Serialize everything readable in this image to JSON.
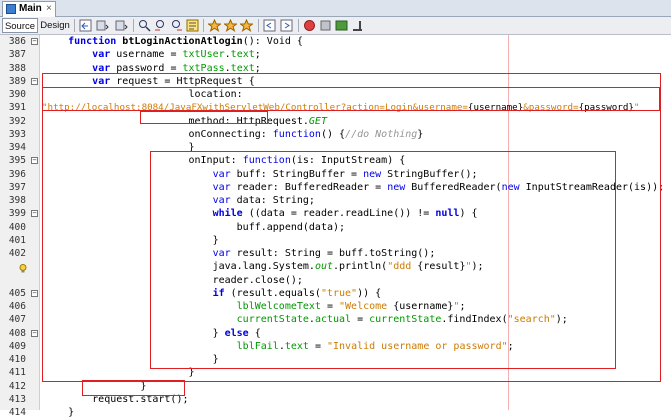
{
  "tab": {
    "title": "Main",
    "close": "×"
  },
  "toolbar": {
    "source_label": "Source",
    "design_label": "Design"
  },
  "colors": {
    "highlight_box": "#e02020",
    "keyword": "#0000e6",
    "string": "#ce7b00",
    "field": "#009900"
  },
  "code": {
    "lines": [
      {
        "n": "386",
        "fold": "minus",
        "text": "    function btLoginActionAtlogin(): Void {"
      },
      {
        "n": "387",
        "fold": "",
        "text": "        var username = txtUser.text;"
      },
      {
        "n": "388",
        "fold": "",
        "text": "        var password = txtPass.text;"
      },
      {
        "n": "389",
        "fold": "minus",
        "text": "        var request = HttpRequest {"
      },
      {
        "n": "390",
        "fold": "",
        "text": "                        location:"
      },
      {
        "n": "391",
        "fold": "",
        "text": "\"http://localhost:8084/JavaFXwithServletWeb/Controller?action=Login&username={username}&password={password}\""
      },
      {
        "n": "392",
        "fold": "",
        "text": "                        method: HttpRequest.GET"
      },
      {
        "n": "393",
        "fold": "",
        "text": "                        onConnecting: function() {//do Nothing}"
      },
      {
        "n": "394",
        "fold": "",
        "text": "                        }"
      },
      {
        "n": "395",
        "fold": "minus",
        "text": "                        onInput: function(is: InputStream) {"
      },
      {
        "n": "396",
        "fold": "",
        "text": "                            var buff: StringBuffer = new StringBuffer();"
      },
      {
        "n": "397",
        "fold": "",
        "text": "                            var reader: BufferedReader = new BufferedReader(new InputStreamReader(is));"
      },
      {
        "n": "398",
        "fold": "",
        "text": "                            var data: String;"
      },
      {
        "n": "399",
        "fold": "minus",
        "text": "                            while ((data = reader.readLine()) != null) {"
      },
      {
        "n": "400",
        "fold": "",
        "text": "                                buff.append(data);"
      },
      {
        "n": "401",
        "fold": "",
        "text": "                            }"
      },
      {
        "n": "402",
        "fold": "",
        "text": "                            var result: String = buff.toString();"
      },
      {
        "n": "",
        "fold": "",
        "text": "                            java.lang.System.out.println(\"ddd {result}\");"
      },
      {
        "n": "",
        "fold": "",
        "text": "                            reader.close();"
      },
      {
        "n": "405",
        "fold": "minus",
        "text": "                            if (result.equals(\"true\")) {"
      },
      {
        "n": "406",
        "fold": "",
        "text": "                                lblWelcomeText = \"Welcome {username}\";"
      },
      {
        "n": "407",
        "fold": "",
        "text": "                                currentState.actual = currentState.findIndex(\"search\");"
      },
      {
        "n": "408",
        "fold": "minus",
        "text": "                            } else {"
      },
      {
        "n": "409",
        "fold": "",
        "text": "                                lblFail.text = \"Invalid username or password\";"
      },
      {
        "n": "410",
        "fold": "",
        "text": "                            }"
      },
      {
        "n": "411",
        "fold": "",
        "text": "                        }"
      },
      {
        "n": "412",
        "fold": "",
        "text": "                }"
      },
      {
        "n": "413",
        "fold": "",
        "text": "        request.start();"
      },
      {
        "n": "414",
        "fold": "",
        "text": "    }"
      }
    ]
  }
}
